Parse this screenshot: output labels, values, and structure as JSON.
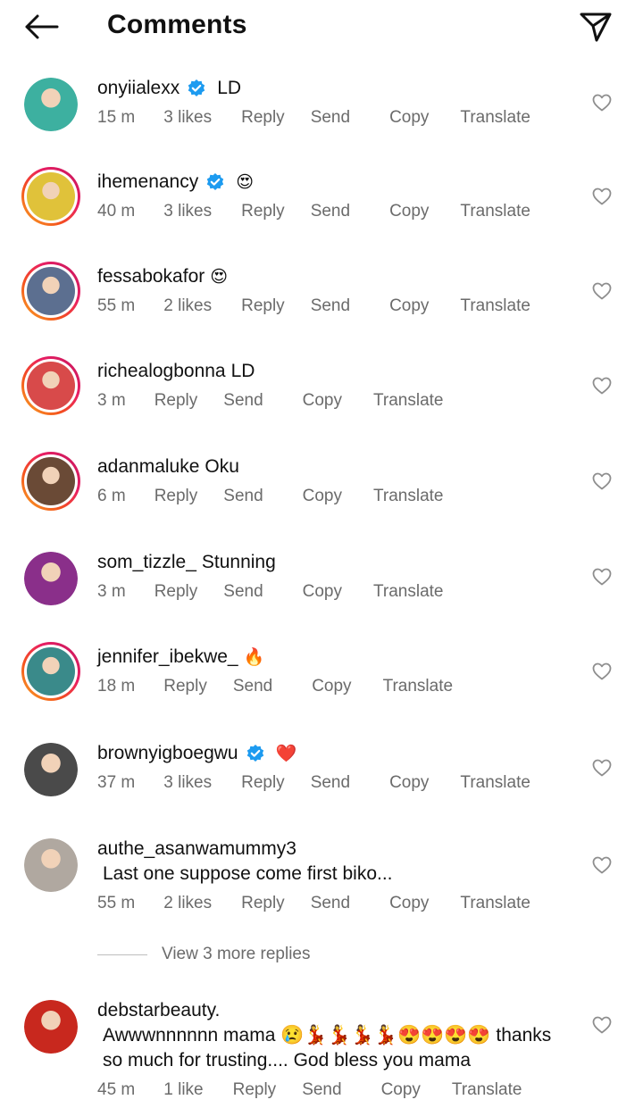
{
  "header": {
    "title": "Comments"
  },
  "comments": [
    {
      "user": "onyiialexx",
      "verified": true,
      "text": "LD",
      "time": "15 m",
      "likes": "3 likes",
      "actions": [
        "Reply",
        "Send",
        "Copy",
        "Translate"
      ],
      "avatar_color": "#3db0a0",
      "ring": false
    },
    {
      "user": "ihemenancy",
      "verified": true,
      "text": "😍",
      "time": "40 m",
      "likes": "3 likes",
      "actions": [
        "Reply",
        "Send",
        "Copy",
        "Translate"
      ],
      "avatar_color": "#e0c23a",
      "ring": true
    },
    {
      "user": "fessabokafor",
      "verified": false,
      "text": "😍",
      "time": "55 m",
      "likes": "2 likes",
      "actions": [
        "Reply",
        "Send",
        "Copy",
        "Translate"
      ],
      "avatar_color": "#5c6f90",
      "ring": true
    },
    {
      "user": "richealogbonna",
      "verified": false,
      "text": "LD",
      "time": "3 m",
      "likes": "",
      "actions": [
        "Reply",
        "Send",
        "Copy",
        "Translate"
      ],
      "avatar_color": "#d84a4a",
      "ring": true
    },
    {
      "user": "adanmaluke",
      "verified": false,
      "text": "Oku",
      "time": "6 m",
      "likes": "",
      "actions": [
        "Reply",
        "Send",
        "Copy",
        "Translate"
      ],
      "avatar_color": "#6a4a36",
      "ring": true
    },
    {
      "user": "som_tizzle_",
      "verified": false,
      "text": "Stunning",
      "time": "3 m",
      "likes": "",
      "actions": [
        "Reply",
        "Send",
        "Copy",
        "Translate"
      ],
      "avatar_color": "#8a2f8a",
      "ring": false
    },
    {
      "user": "jennifer_ibekwe_",
      "verified": false,
      "text": "🔥",
      "time": "18 m",
      "likes": "",
      "actions": [
        "Reply",
        "Send",
        "Copy",
        "Translate"
      ],
      "avatar_color": "#3a8a8a",
      "ring": true
    },
    {
      "user": "brownyigboegwu",
      "verified": true,
      "text": "❤️",
      "time": "37 m",
      "likes": "3 likes",
      "actions": [
        "Reply",
        "Send",
        "Copy",
        "Translate"
      ],
      "avatar_color": "#4a4a4a",
      "ring": false
    },
    {
      "user": "authe_asanwamummy3",
      "verified": false,
      "text": "Last one suppose come first biko...",
      "time": "55 m",
      "likes": "2 likes",
      "actions": [
        "Reply",
        "Send",
        "Copy",
        "Translate"
      ],
      "avatar_color": "#b0a8a0",
      "ring": false
    },
    {
      "user": "debstarbeauty.",
      "verified": false,
      "text": "Awwwnnnnnn mama 😢💃💃💃💃😍😍😍😍 thanks so much for trusting.... God bless you mama",
      "time": "45 m",
      "likes": "1 like",
      "actions": [
        "Reply",
        "Send",
        "Copy",
        "Translate"
      ],
      "avatar_color": "#c8281e",
      "ring": false
    }
  ],
  "view_more": "View 3 more replies",
  "colors": {
    "verified": "#1d9bf0",
    "muted": "#6b6b6b"
  }
}
